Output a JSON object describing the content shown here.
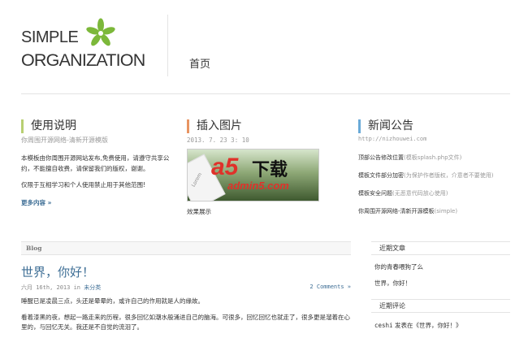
{
  "logo": {
    "line1": "SIMPLE",
    "line2": "ORGANIZATION"
  },
  "nav": {
    "home": "首页"
  },
  "col1": {
    "title": "使用说明",
    "subtitle": "你周围开源网络-清新开源模版",
    "para1": "本模板由你周围开源网站发布,免费使用，请遵守共享公约，不能擅自收费，请保留我们的版权，谢谢。",
    "para2": "仅限于互相学习和个人使用禁止用于其他范围!",
    "more": "更多内容 »"
  },
  "col2": {
    "title": "插入图片",
    "date": "2013. 7. 23 3: 10",
    "image_text": "Lorem",
    "watermark": {
      "a5": "a5",
      "xz": "下载",
      "domain": "admin5.com"
    },
    "caption": "效果展示"
  },
  "col3": {
    "title": "新闻公告",
    "url": "http://nizhouwei.com",
    "items": [
      {
        "main": "顶部公告修改位置",
        "note": "(模板splash.php文件)"
      },
      {
        "main": "模板文件部分加密",
        "note": "(为保护作者版权，介意者不要使用)"
      },
      {
        "main": "模板安全问题",
        "note": "(无恶意代码放心使用)"
      },
      {
        "main": "你周围开源网络-清新开源模板",
        "note": "(simple)"
      }
    ]
  },
  "blog": {
    "heading": "Blog",
    "post": {
      "title": "世界，你好！",
      "date": "六月 16th, 2013 in",
      "category": "未分类",
      "comments": "2 Comments »",
      "para1": "睡醒已是凌晨三点，头还是晕晕的，或许自己的作用就是人的缘故。",
      "para2": "看着漆黑的夜，想起一路走来的历程，很多回忆如潮水般涌进自己的脑海。可很多，回忆回忆也就走了，很多更是溜着在心里的，与回忆无关。我还是不自觉的流泪了。"
    }
  },
  "sidebar": {
    "recent_posts_heading": "近期文章",
    "recent_posts": [
      "你的青春喂狗了么",
      "世界，你好！"
    ],
    "recent_comments_heading": "近期评论",
    "recent_comment": {
      "user": "ceshi",
      "text": "发表在《世界，你好！》"
    }
  }
}
